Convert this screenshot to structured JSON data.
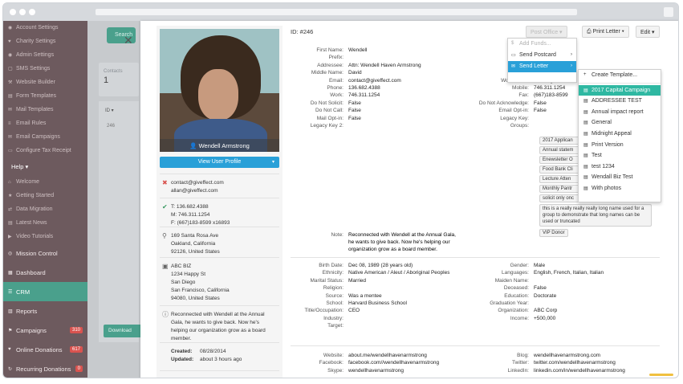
{
  "sidebar": {
    "top_items": [
      {
        "icon": "user-icon",
        "label": "Account Settings"
      },
      {
        "icon": "heart-icon",
        "label": "Charity Settings"
      },
      {
        "icon": "user-icon",
        "label": "Admin Settings"
      },
      {
        "icon": "chat-icon",
        "label": "SMS Settings"
      },
      {
        "icon": "build-icon",
        "label": "Website Builder"
      },
      {
        "icon": "form-icon",
        "label": "Form Templates"
      },
      {
        "icon": "mail-icon",
        "label": "Mail Templates"
      },
      {
        "icon": "rules-icon",
        "label": "Email Rules"
      },
      {
        "icon": "mail-icon",
        "label": "Email Campaigns"
      },
      {
        "icon": "receipt-icon",
        "label": "Configure Tax Receipt"
      }
    ],
    "help_label": "Help ▾",
    "help_items": [
      {
        "icon": "home-icon",
        "label": "Welcome"
      },
      {
        "icon": "star-icon",
        "label": "Getting Started"
      },
      {
        "icon": "migrate-icon",
        "label": "Data Migration"
      },
      {
        "icon": "news-icon",
        "label": "Latest News"
      },
      {
        "icon": "video-icon",
        "label": "Video Tutorials"
      }
    ],
    "main_items": [
      {
        "icon": "mission-icon",
        "label": "Mission Control",
        "badge": ""
      },
      {
        "icon": "dashboard-icon",
        "label": "Dashboard",
        "badge": ""
      },
      {
        "icon": "crm-icon",
        "label": "CRM",
        "badge": "",
        "active": true
      },
      {
        "icon": "reports-icon",
        "label": "Reports",
        "badge": ""
      },
      {
        "icon": "campaign-icon",
        "label": "Campaigns",
        "badge": "310"
      },
      {
        "icon": "donation-icon",
        "label": "Online Donations",
        "badge": "617"
      },
      {
        "icon": "recurring-icon",
        "label": "Recurring Donations",
        "badge": "0"
      }
    ]
  },
  "background": {
    "btn": "Search",
    "contacts_label": "Contacts",
    "contacts_value": "1",
    "id_header": "ID ▾",
    "row_id": "246",
    "download": "Download"
  },
  "profile": {
    "name": "Wendell Armstrong",
    "view_profile": "View User Profile",
    "emails": [
      "contact@giveffect.com",
      "allan@giveffect.com"
    ],
    "phones": [
      "T: 136.682.4388",
      "M: 746.311.1254",
      "F: (667)183-8599 x16893"
    ],
    "home_address": [
      "169 Santa Rosa Ave",
      "Oakland, California",
      "92126, United States"
    ],
    "biz_address": [
      "ABC BIZ",
      "1234 Happy St",
      "San Diego",
      "San Francisco, California",
      "94080, United States"
    ],
    "note": "Reconnected with Wendell at the Annual Gala, he wants to give back. Now he's helping our organization grow as a board member.",
    "created_label": "Created:",
    "created": "08/28/2014",
    "updated_label": "Updated:",
    "updated": "about 3 hours ago"
  },
  "toolbar": {
    "id_label": "ID: #246",
    "post_office": "Post Office ▾",
    "print_letter": "⎙ Print Letter ▾",
    "edit": "Edit ▾"
  },
  "fields_left": [
    {
      "k": "First Name:",
      "v": "Wendell"
    },
    {
      "k": "Prefix:",
      "v": ""
    },
    {
      "k": "Addressee:",
      "v": "Attn: Wendell Haven Armstrong"
    },
    {
      "k": "Middle Name:",
      "v": "David"
    },
    {
      "k": "Email:",
      "v": "contact@giveffect.com"
    },
    {
      "k": "Phone:",
      "v": "136.682.4388"
    },
    {
      "k": "Work:",
      "v": "746.311.1254"
    },
    {
      "k": "Do Not Solicit:",
      "v": "False"
    },
    {
      "k": "Do Not Call:",
      "v": "False"
    },
    {
      "k": "Mail Opt-in:",
      "v": "False"
    },
    {
      "k": "Legacy Key 2:",
      "v": ""
    }
  ],
  "fields_right": [
    {
      "k": "L",
      "v": ""
    },
    {
      "k": "",
      "v": ""
    },
    {
      "k": "",
      "v": ""
    },
    {
      "k": "Prefer",
      "v": ""
    },
    {
      "k": "Work Email:",
      "v": "allan@giveffect."
    },
    {
      "k": "Mobile:",
      "v": "746.311.1254"
    },
    {
      "k": "Fax:",
      "v": "(667)183-8599"
    },
    {
      "k": "Do Not Acknowledge:",
      "v": "False"
    },
    {
      "k": "Email Opt-in:",
      "v": "False"
    },
    {
      "k": "Legacy Key:",
      "v": ""
    },
    {
      "k": "Groups:",
      "v": ""
    }
  ],
  "groups": [
    "2017 Applican",
    "Annual statem",
    "Enewsletter O",
    "Food Bank Cli",
    "Lecture Atten",
    "Monthly Pantr",
    "solicit only onc"
  ],
  "groups_long": "this is a really really really long name used for a group to demonstrate that long names can be used or truncated",
  "groups_last": "VIP Donor",
  "note_label": "Note:",
  "note_text": [
    "Reconnected with Wendell at the Annual Gala,",
    "he wants to give back. Now he's helping our",
    "organization grow as a board member."
  ],
  "details_left": [
    {
      "k": "Birth Date:",
      "v": "Dec 08, 1989 (28 years old)"
    },
    {
      "k": "Ethnicity:",
      "v": "Native American / Aleut / Aboriginal Peoples"
    },
    {
      "k": "Marital Status:",
      "v": "Married"
    },
    {
      "k": "Religion:",
      "v": ""
    },
    {
      "k": "Source:",
      "v": "Was a mentee"
    },
    {
      "k": "School:",
      "v": "Harvard Business School"
    },
    {
      "k": "Title/Occupation:",
      "v": "CEO"
    },
    {
      "k": "Industry:",
      "v": ""
    },
    {
      "k": "Target:",
      "v": ""
    }
  ],
  "details_right": [
    {
      "k": "Gender:",
      "v": "Male"
    },
    {
      "k": "Languages:",
      "v": "English, French, Italian, Italian"
    },
    {
      "k": "Maiden Name:",
      "v": ""
    },
    {
      "k": "Deceased:",
      "v": "False"
    },
    {
      "k": "Education:",
      "v": "Doctorate"
    },
    {
      "k": "Graduation Year:",
      "v": ""
    },
    {
      "k": "Organization:",
      "v": "ABC Corp"
    },
    {
      "k": "Income:",
      "v": "+500,000"
    }
  ],
  "social_left": [
    {
      "k": "Website:",
      "v": "about.me/wendellhavenarmstrong"
    },
    {
      "k": "Facebook:",
      "v": "facebook.com//wendellhavenarmstrong"
    },
    {
      "k": "Skype:",
      "v": "wendellhavenarmstrong"
    }
  ],
  "social_right": [
    {
      "k": "Blog:",
      "v": "wendellhavenarmstrong.com"
    },
    {
      "k": "Twitter:",
      "v": "twitter.com/wendellhavenarmstrong"
    },
    {
      "k": "LinkedIn:",
      "v": "linkedin.com/in/wendellhavenarmstrong"
    }
  ],
  "post_office_menu": [
    {
      "icon": "money-icon",
      "label": "Add Funds...",
      "state": "disabled"
    },
    {
      "icon": "postcard-icon",
      "label": "Send Postcard",
      "state": "normal"
    },
    {
      "icon": "letter-icon",
      "label": "Send Letter",
      "state": "active"
    }
  ],
  "letter_menu": {
    "create": "Create Template...",
    "items": [
      {
        "label": "2017 Capital Campaign",
        "active": true
      },
      {
        "label": "ADDRESSEE TEST",
        "active": false
      },
      {
        "label": "Annual impact report",
        "active": false
      },
      {
        "label": "General",
        "active": false
      },
      {
        "label": "Midnight Appeal",
        "active": false
      },
      {
        "label": "Print Version",
        "active": false
      },
      {
        "label": "Test",
        "active": false
      },
      {
        "label": "test 1234",
        "active": false
      },
      {
        "label": "Wendall Biz Test",
        "active": false
      },
      {
        "label": "With photos",
        "active": false
      }
    ]
  },
  "colors": {
    "sidebar_bg": "#6d5a5e",
    "accent_teal": "#4aa08c",
    "accent_blue": "#29a0d8",
    "menu_active": "#2fb8a2"
  }
}
